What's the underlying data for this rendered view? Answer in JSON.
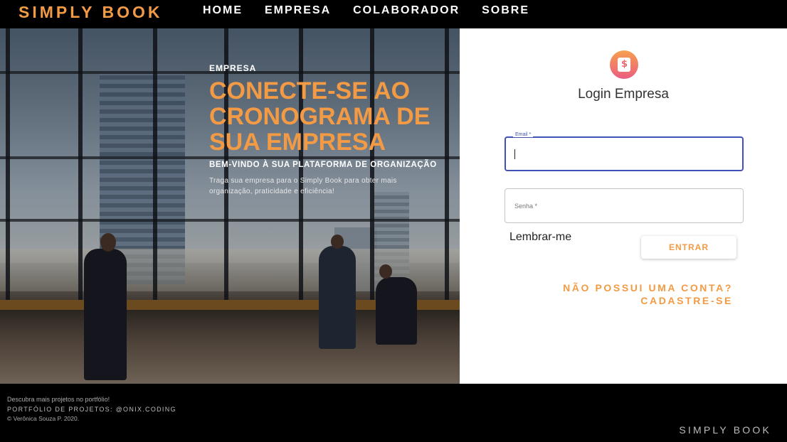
{
  "nav": {
    "brand": "SIMPLY BOOK",
    "links": [
      "HOME",
      "EMPRESA",
      "COLABORADOR",
      "SOBRE"
    ]
  },
  "hero": {
    "kicker": "EMPRESA",
    "title": "CONECTE-SE AO CRONOGRAMA DE SUA EMPRESA",
    "subtitle": "BEM-VINDO À SUA PLATAFORMA DE ORGANIZAÇÃO",
    "description": "Traga sua empresa para o Simply Book para obter mais organização, praticidade e eficiência!"
  },
  "login": {
    "title": "Login Empresa",
    "email_label": "Email *",
    "email_value": "",
    "password_placeholder": "Senha *",
    "remember_label": "Lembrar-me",
    "submit_label": "ENTRAR",
    "signup_line1": "NÃO POSSUI UMA CONTA?",
    "signup_line2": "CADASTRE-SE"
  },
  "footer": {
    "line1": "Descubra mais projetos no portfólio!",
    "line2": "PORTFÓLIO DE PROJETOS: @ONIX.CODING",
    "line3": "© Verônica Souza P. 2020.",
    "brand": "SIMPLY BOOK"
  },
  "colors": {
    "accent": "#f39a45",
    "focus": "#3f51b5",
    "background": "#000000"
  },
  "icons": {
    "logo": "schedule-book-icon"
  }
}
